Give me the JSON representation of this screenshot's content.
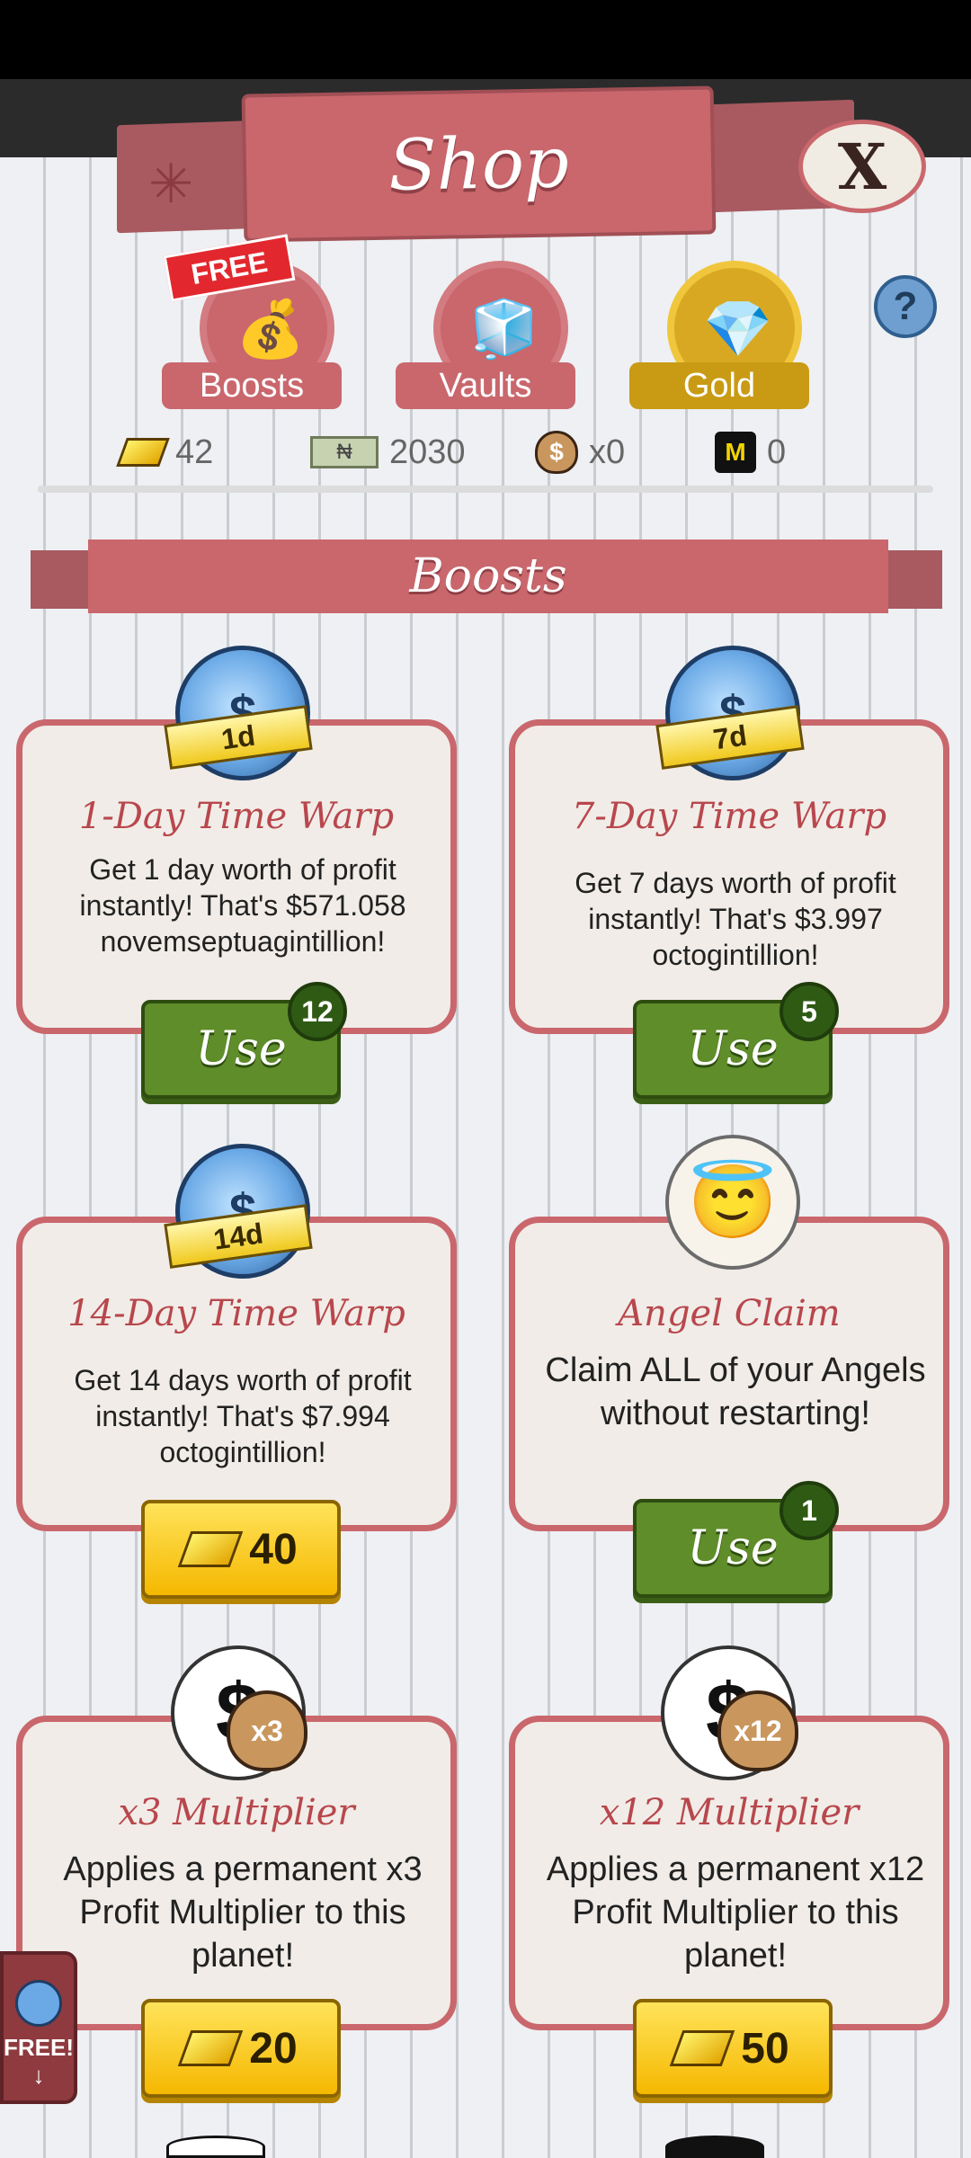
{
  "header": {
    "title": "Shop",
    "close_label": "X",
    "help_label": "?"
  },
  "tabs": [
    {
      "label": "Boosts",
      "badge": "FREE",
      "icon": "boost-bag-icon"
    },
    {
      "label": "Vaults",
      "icon": "vault-icon"
    },
    {
      "label": "Gold",
      "icon": "gold-gem-icon",
      "selected": true
    }
  ],
  "currencies": [
    {
      "icon": "gold-gem-icon",
      "value": "42"
    },
    {
      "icon": "mega-bucks-icon",
      "glyph": "₦",
      "value": "2030"
    },
    {
      "icon": "money-bag-icon",
      "value": "x0"
    },
    {
      "icon": "megaticket-icon",
      "value": "0"
    }
  ],
  "section": {
    "title": "Boosts"
  },
  "cards": [
    {
      "title": "1-Day Time Warp",
      "desc": "Get 1 day worth of profit instantly! That's $571.058 novemseptuagintillion!",
      "icon_label": "1d",
      "button": "Use",
      "count": "12"
    },
    {
      "title": "7-Day Time Warp",
      "desc": "Get 7 days worth of profit instantly! That's $3.997 octogintillion!",
      "icon_label": "7d",
      "button": "Use",
      "count": "5"
    },
    {
      "title": "14-Day Time Warp",
      "desc": "Get 14 days worth of profit instantly! That's $7.994 octogintillion!",
      "icon_label": "14d",
      "price": "40"
    },
    {
      "title": "Angel Claim",
      "desc": "Claim ALL of your Angels without restarting!",
      "button": "Use",
      "count": "1"
    },
    {
      "title": "x3 Multiplier",
      "desc": "Applies a permanent x3 Profit Multiplier to this planet!",
      "icon_label": "x3",
      "price": "20"
    },
    {
      "title": "x12 Multiplier",
      "desc": "Applies a permanent x12 Profit Multiplier to this planet!",
      "icon_label": "x12",
      "price": "50"
    }
  ],
  "side_tab": {
    "label": "FREE!",
    "arrow": "↓"
  },
  "colors": {
    "accent": "#c9676d",
    "use_green": "#5f8d2a",
    "gold": "#f5b800"
  }
}
